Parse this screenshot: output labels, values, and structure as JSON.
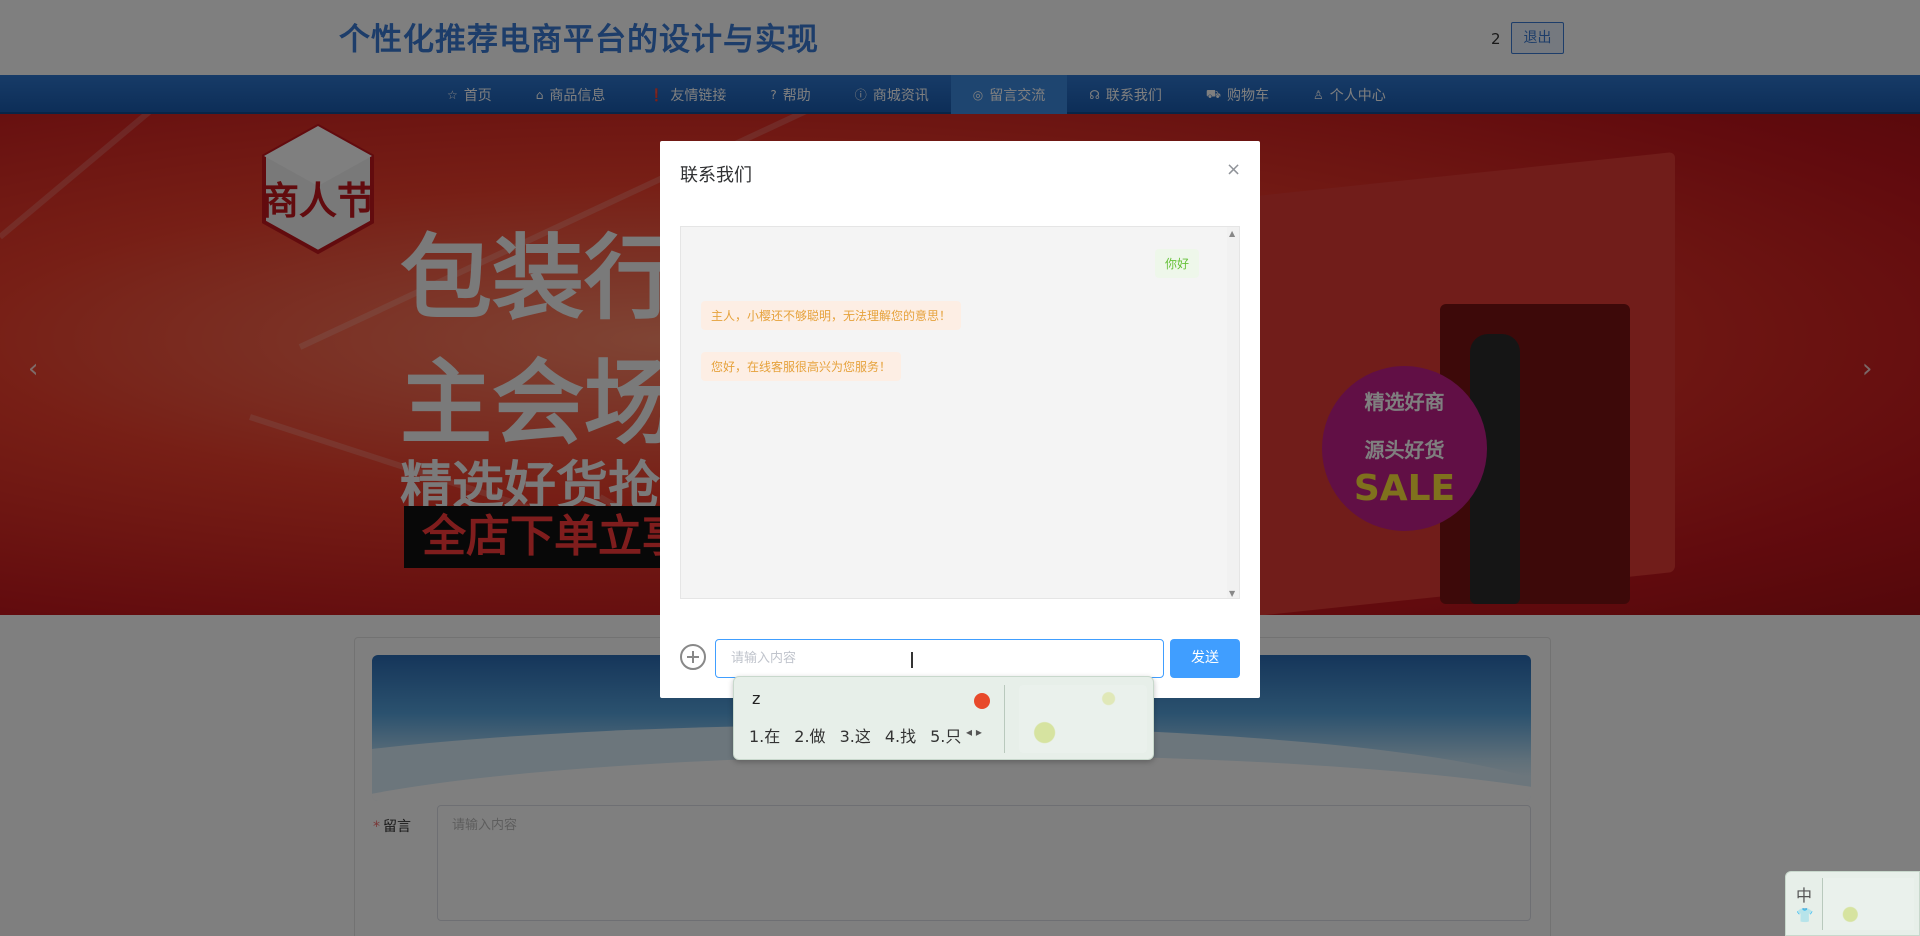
{
  "header": {
    "site_title": "个性化推荐电商平台的设计与实现",
    "user_id": "2",
    "logout_label": "退出"
  },
  "nav": {
    "items": [
      {
        "label": "首页",
        "icon": "star-icon",
        "glyph": "☆"
      },
      {
        "label": "商品信息",
        "icon": "home-icon",
        "glyph": "⌂"
      },
      {
        "label": "友情链接",
        "icon": "alert-icon",
        "glyph": "❗"
      },
      {
        "label": "帮助",
        "icon": "question-icon",
        "glyph": "?"
      },
      {
        "label": "商城资讯",
        "icon": "info-icon",
        "glyph": "ⓘ"
      },
      {
        "label": "留言交流",
        "icon": "target-icon",
        "glyph": "◎"
      },
      {
        "label": "联系我们",
        "icon": "headset-icon",
        "glyph": "☊"
      },
      {
        "label": "购物车",
        "icon": "cart-icon",
        "glyph": "⛟"
      },
      {
        "label": "个人中心",
        "icon": "user-icon",
        "glyph": "♙"
      }
    ],
    "active_index": 5
  },
  "banner": {
    "logo_text": "商人节",
    "promo_line1": "包装行",
    "promo_line2": "主会场",
    "promo_line3": "精选好货抢",
    "promo_bar": "全店下单立享优",
    "sale_line1": "精选好商",
    "sale_line2": "源头好货",
    "sale_word": "SALE",
    "arrow_left": "‹",
    "arrow_right": "›"
  },
  "message_form": {
    "label": "留言",
    "placeholder": "请输入内容"
  },
  "dialog": {
    "title": "联系我们",
    "close_glyph": "×",
    "messages": [
      {
        "from": "me",
        "text": "你好"
      },
      {
        "from": "bot",
        "text": "主人，小樱还不够聪明，无法理解您的意思！"
      },
      {
        "from": "bot",
        "text": "您好，在线客服很高兴为您服务！"
      }
    ],
    "input_placeholder": "请输入内容",
    "send_label": "发送"
  },
  "ime": {
    "composition": "z",
    "candidates": [
      "1.在",
      "2.做",
      "3.这",
      "4.找",
      "5.只"
    ],
    "pager": "◂ ▸",
    "status_mode": "中",
    "status_icon": "shirt-icon"
  },
  "colors": {
    "brand_blue": "#3a7bd5",
    "nav_blue": "#1a5cb0",
    "primary_button": "#409eff",
    "bot_bubble_text": "#e6a23c",
    "user_bubble_text": "#67c23a"
  }
}
